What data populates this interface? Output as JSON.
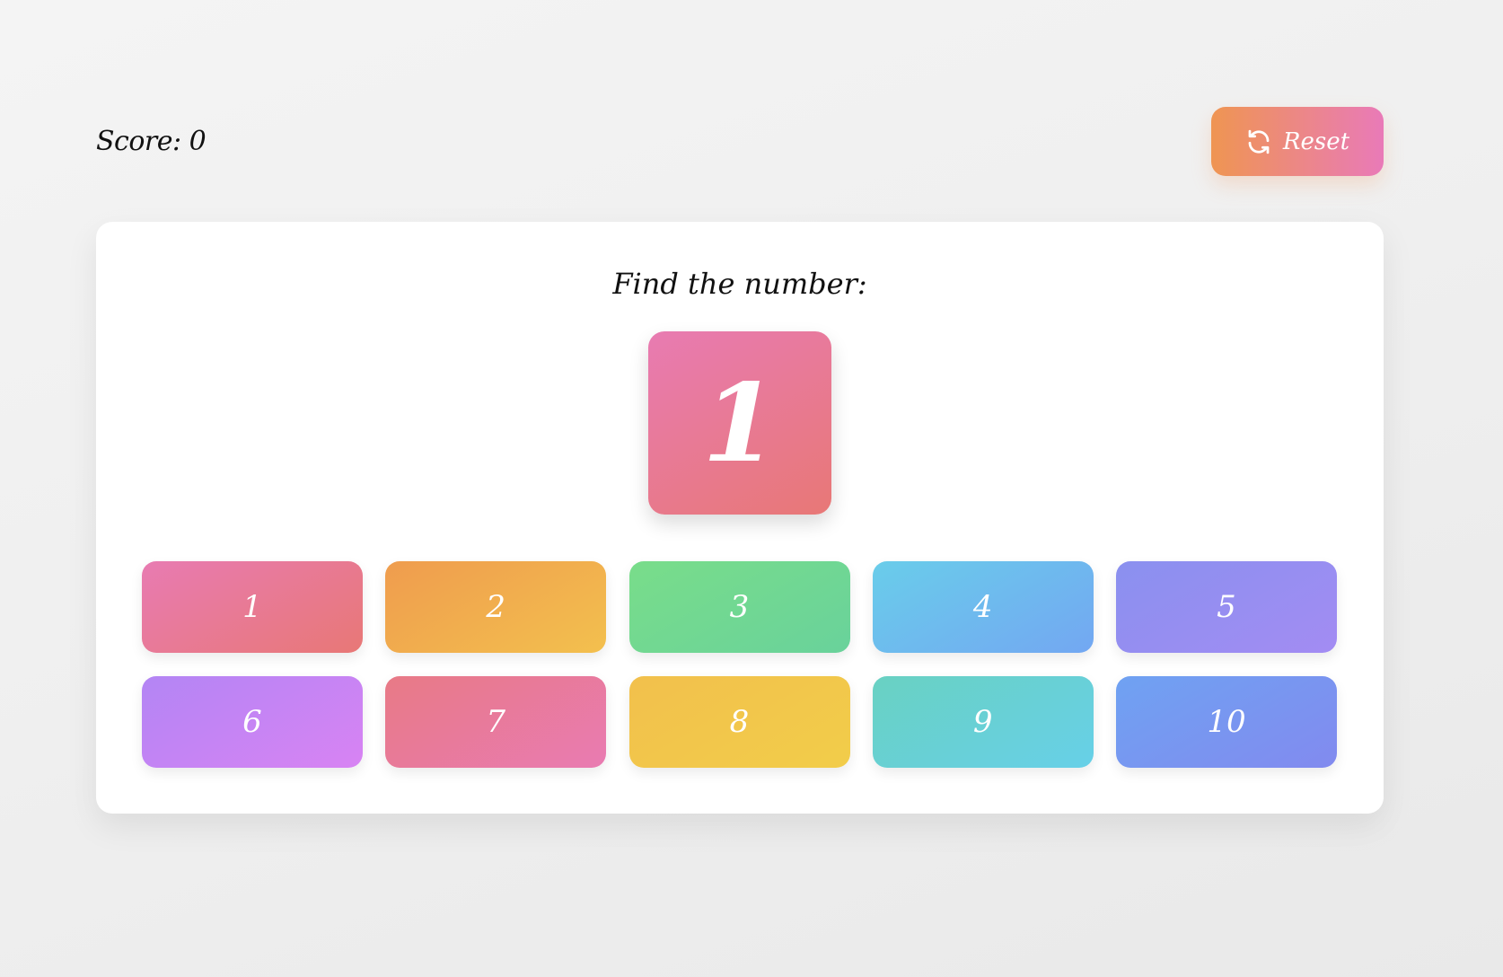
{
  "header": {
    "score_label": "Score: 0",
    "reset_label": "Reset",
    "reset_icon": "refresh-icon"
  },
  "game": {
    "prompt": "Find the number:",
    "target_number": "1",
    "choices": [
      "1",
      "2",
      "3",
      "4",
      "5",
      "6",
      "7",
      "8",
      "9",
      "10"
    ]
  },
  "colors": {
    "background": "#efefef",
    "card": "#ffffff",
    "reset_gradient": [
      "#ef9552",
      "#e97ab8"
    ],
    "target_gradient": [
      "#e87bb2",
      "#e87876"
    ],
    "choice_gradients": [
      [
        "#e87bb2",
        "#e87876"
      ],
      [
        "#ef9c4e",
        "#f3c04e"
      ],
      [
        "#79dd8a",
        "#69d29b"
      ],
      [
        "#69cdea",
        "#73a7f2"
      ],
      [
        "#8a90ef",
        "#a38cf3"
      ],
      [
        "#b385f4",
        "#d883f3"
      ],
      [
        "#e87a86",
        "#e97bb2"
      ],
      [
        "#f2c04c",
        "#f2cd4a"
      ],
      [
        "#69d1c2",
        "#67d0e8"
      ],
      [
        "#6fa2f2",
        "#828aef"
      ]
    ]
  }
}
